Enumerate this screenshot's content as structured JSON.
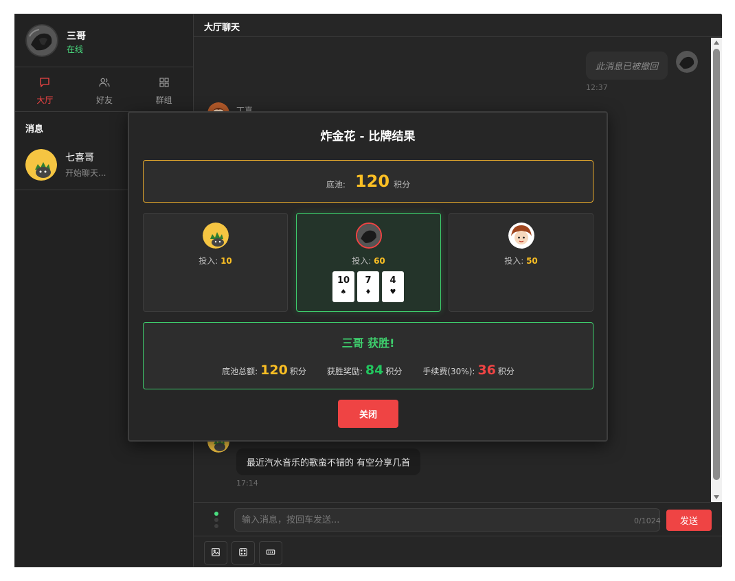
{
  "user": {
    "name": "三哥",
    "status": "在线"
  },
  "tabs": [
    {
      "label": "大厅",
      "icon": "chat-bubble-icon",
      "active": true
    },
    {
      "label": "好友",
      "icon": "users-icon",
      "active": false
    },
    {
      "label": "群组",
      "icon": "grid-icon",
      "active": false
    }
  ],
  "sidebar": {
    "section_title": "消息",
    "conversations": [
      {
        "name": "七喜哥",
        "last_message": "开始聊天..."
      }
    ]
  },
  "chat": {
    "title": "大厅聊天",
    "messages": {
      "recalled": {
        "text": "此消息已被撤回",
        "time": "12:37"
      },
      "peer1": {
        "sender": "丁真"
      },
      "peer2": {
        "text": "最近汽水音乐的歌蛮不错的 有空分享几首",
        "time": "17:14"
      }
    },
    "input": {
      "placeholder": "输入消息，按回车发送...",
      "value": "",
      "counter": "0/1024"
    },
    "send_label": "发送",
    "tools": [
      "image-icon",
      "dice-icon",
      "ticket-icon"
    ]
  },
  "modal": {
    "title": "炸金花 - 比牌结果",
    "pot": {
      "label": "底池:",
      "value": "120",
      "unit": "积分"
    },
    "players": [
      {
        "bet_label": "投入:",
        "bet": "10",
        "winner": false
      },
      {
        "bet_label": "投入:",
        "bet": "60",
        "winner": true,
        "cards": [
          {
            "rank": "10",
            "suit": "♠"
          },
          {
            "rank": "7",
            "suit": "♦"
          },
          {
            "rank": "4",
            "suit": "♥"
          }
        ]
      },
      {
        "bet_label": "投入:",
        "bet": "50",
        "winner": false
      }
    ],
    "result": {
      "title": "三哥 获胜!",
      "total_label": "底池总额:",
      "total": "120",
      "total_unit": "积分",
      "reward_label": "获胜奖励:",
      "reward": "84",
      "reward_unit": "积分",
      "fee_label": "手续费(30%):",
      "fee": "36",
      "fee_unit": "积分"
    },
    "close_label": "关闭"
  },
  "colors": {
    "accent": "#ef4444",
    "online": "#4ade80",
    "gold": "#fbbf24",
    "win": "#3ecf6d"
  }
}
